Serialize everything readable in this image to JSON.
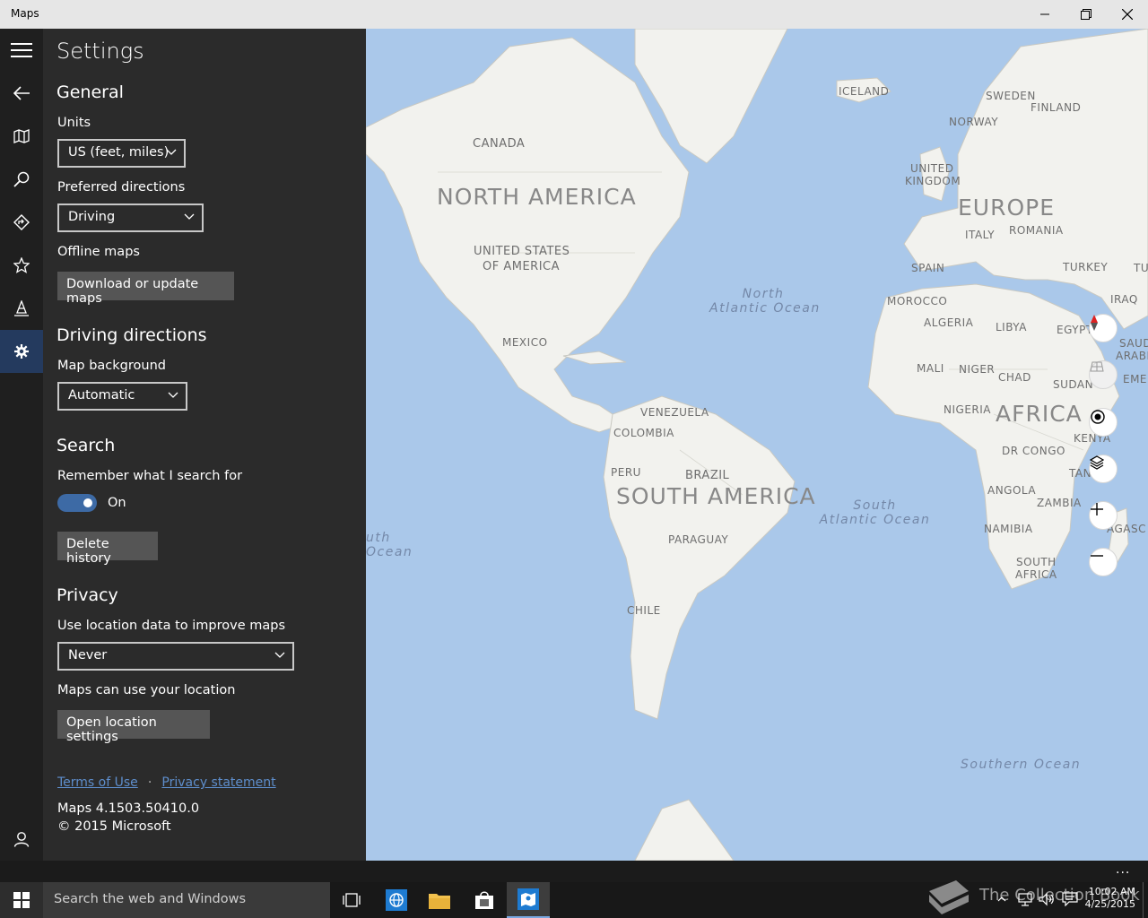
{
  "window": {
    "title": "Maps"
  },
  "settings": {
    "title": "Settings",
    "general": {
      "heading": "General",
      "units_label": "Units",
      "units_value": "US (feet, miles)",
      "directions_label": "Preferred directions",
      "directions_value": "Driving",
      "offline_label": "Offline maps",
      "offline_button": "Download or update maps"
    },
    "driving": {
      "heading": "Driving directions",
      "bg_label": "Map background",
      "bg_value": "Automatic"
    },
    "search": {
      "heading": "Search",
      "remember_label": "Remember what I search for",
      "toggle_state": "On",
      "delete_button": "Delete history"
    },
    "privacy": {
      "heading": "Privacy",
      "location_label": "Use location data to improve maps",
      "location_value": "Never",
      "can_use_label": "Maps can use your location",
      "open_button": "Open location settings"
    },
    "links": {
      "terms": "Terms of Use",
      "separator": "·",
      "privacy": "Privacy statement"
    },
    "version": "Maps 4.1503.50410.0",
    "copyright": "© 2015 Microsoft"
  },
  "map": {
    "continents": [
      "NORTH AMERICA",
      "SOUTH AMERICA",
      "EUROPE",
      "AFRICA"
    ],
    "countries": [
      "CANADA",
      "UNITED STATES",
      "OF AMERICA",
      "MEXICO",
      "VENEZUELA",
      "COLOMBIA",
      "PERU",
      "BRAZIL",
      "PARAGUAY",
      "CHILE",
      "ICELAND",
      "SWEDEN",
      "FINLAND",
      "NORWAY",
      "UNITED",
      "KINGDOM",
      "ITALY",
      "ROMANIA",
      "SPAIN",
      "TURKEY",
      "TU",
      "MOROCCO",
      "ALGERIA",
      "LIBYA",
      "EGYPT",
      "IRAQ",
      "SAUDI",
      "ARABIA",
      "MALI",
      "NIGER",
      "CHAD",
      "SUDAN",
      "EMEN",
      "NIGERIA",
      "KENYA",
      "DR CONGO",
      "TANZA",
      "ANGOLA",
      "ZAMBIA",
      "NAMIBIA",
      "AGASC",
      "SOUTH",
      "AFRICA"
    ],
    "oceans": {
      "north_atlantic_1": "North",
      "north_atlantic_2": "Atlantic Ocean",
      "south_atlantic_1": "South",
      "south_atlantic_2": "Atlantic Ocean",
      "pacific_1": "uth",
      "pacific_2": "Ocean",
      "southern": "Southern Ocean"
    }
  },
  "taskbar": {
    "search_placeholder": "Search the web and Windows",
    "time": "10:02 AM",
    "date": "4/25/2015",
    "watermark": "The Collection Book",
    "more": "..."
  },
  "colors": {
    "accent": "#3d6aa5",
    "pane": "#2b2b2b",
    "rail": "#1f1f1f",
    "ocean": "#aac8ea",
    "land": "#f2f2ee"
  }
}
